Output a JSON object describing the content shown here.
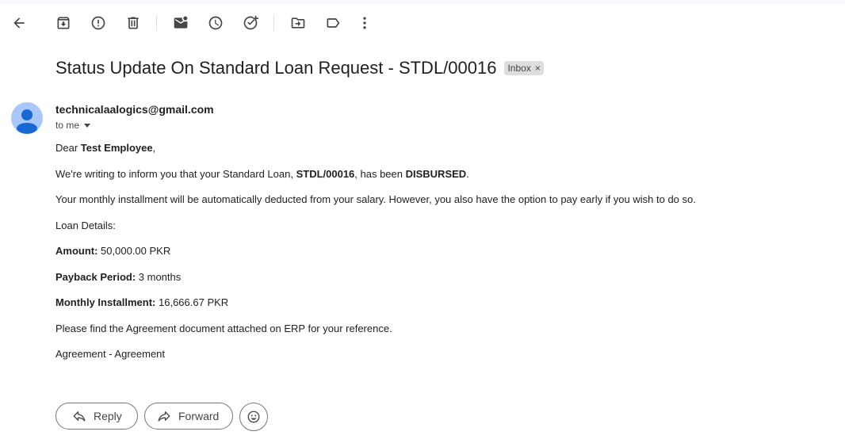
{
  "colors": {
    "icon": "#444746",
    "avatar_bg": "#a8c7fa",
    "avatar_fg": "#1967d2",
    "chip_bg": "#dddddd"
  },
  "toolbar": {
    "icons": [
      "back-arrow-icon",
      "archive-icon",
      "report-spam-icon",
      "delete-icon",
      "mark-unread-icon",
      "snooze-icon",
      "add-task-icon",
      "move-to-icon",
      "label-icon",
      "more-vert-icon"
    ]
  },
  "email": {
    "subject": "Status Update On Standard Loan Request - STDL/00016",
    "label": "Inbox",
    "label_close": "×",
    "sender": "technicalaalogics@gmail.com",
    "recipient_text": "to me",
    "greeting_prefix": "Dear ",
    "greeting_name": "Test Employee",
    "greeting_suffix": ",",
    "line1_prefix": "We're writing to inform you that your Standard Loan, ",
    "line1_id": "STDL/00016",
    "line1_mid": ", has been ",
    "line1_status": "DISBURSED",
    "line1_suffix": ".",
    "line2": "Your monthly installment will be automatically deducted from your salary. However, you also have the option to pay early if you wish to do so.",
    "details_heading": "Loan Details:",
    "amount_label": "Amount:",
    "amount_value": " 50,000.00 PKR",
    "period_label": "Payback Period:",
    "period_value": " 3 months",
    "installment_label": "Monthly Installment:",
    "installment_value": " 16,666.67 PKR",
    "line3": "Please find the Agreement document attached on ERP for your reference.",
    "attachment": "Agreement - Agreement"
  },
  "actions": {
    "reply": "Reply",
    "forward": "Forward"
  }
}
